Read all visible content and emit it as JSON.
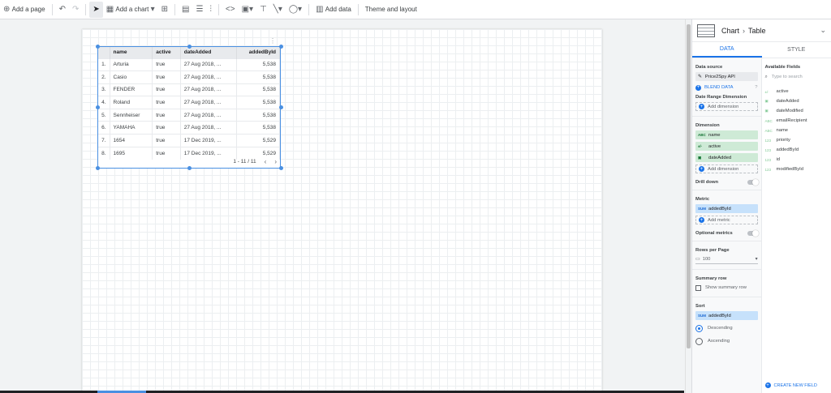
{
  "toolbar": {
    "add_page": "Add a page",
    "add_chart": "Add a chart",
    "add_data": "Add data",
    "theme": "Theme and layout"
  },
  "table": {
    "headers": [
      "name",
      "active",
      "dateAdded",
      "addedById"
    ],
    "rows": [
      {
        "idx": "1.",
        "name": "Arturia",
        "active": "true",
        "date": "27 Aug 2018, ...",
        "added": "5,538"
      },
      {
        "idx": "2.",
        "name": "Casio",
        "active": "true",
        "date": "27 Aug 2018, ...",
        "added": "5,538"
      },
      {
        "idx": "3.",
        "name": "FENDER",
        "active": "true",
        "date": "27 Aug 2018, ...",
        "added": "5,538"
      },
      {
        "idx": "4.",
        "name": "Roland",
        "active": "true",
        "date": "27 Aug 2018, ...",
        "added": "5,538"
      },
      {
        "idx": "5.",
        "name": "Sennheiser",
        "active": "true",
        "date": "27 Aug 2018, ...",
        "added": "5,538"
      },
      {
        "idx": "6.",
        "name": "YAMAHA",
        "active": "true",
        "date": "27 Aug 2018, ...",
        "added": "5,538"
      },
      {
        "idx": "7.",
        "name": "1654",
        "active": "true",
        "date": "17 Dec 2019, ...",
        "added": "5,529"
      },
      {
        "idx": "8.",
        "name": "1695",
        "active": "true",
        "date": "17 Dec 2019, ...",
        "added": "5,529"
      }
    ],
    "pager": "1 - 11 / 11"
  },
  "panel": {
    "title": "Chart",
    "subtitle": "Table",
    "tab_data": "DATA",
    "tab_style": "STYLE",
    "data_source_label": "Data source",
    "data_source": "Price2Spy API",
    "blend": "BLEND DATA",
    "date_range_label": "Date Range Dimension",
    "add_dimension": "Add dimension",
    "dimension_label": "Dimension",
    "dimensions": [
      {
        "pre": "ABC",
        "name": "name"
      },
      {
        "pre": "±/·",
        "name": "active"
      },
      {
        "pre": "▣",
        "name": "dateAdded"
      }
    ],
    "drill_down": "Drill down",
    "metric_label": "Metric",
    "metric": {
      "pre": "SUM",
      "name": "addedById"
    },
    "add_metric": "Add metric",
    "optional_metrics": "Optional metrics",
    "rows_label": "Rows per Page",
    "rows_value": "100",
    "summary_label": "Summary row",
    "show_summary": "Show summary row",
    "sort_label": "Sort",
    "sort_field": {
      "pre": "SUM",
      "name": "addedById"
    },
    "descending": "Descending",
    "ascending": "Ascending",
    "available_label": "Available Fields",
    "search_placeholder": "Type to search",
    "fields": [
      {
        "pre": "±/·",
        "name": "active"
      },
      {
        "pre": "▣",
        "name": "dateAdded"
      },
      {
        "pre": "▣",
        "name": "dateModified"
      },
      {
        "pre": "ABC",
        "name": "emailRecipient"
      },
      {
        "pre": "ABC",
        "name": "name"
      },
      {
        "pre": "123",
        "name": "priority"
      },
      {
        "pre": "123",
        "name": "addedById"
      },
      {
        "pre": "123",
        "name": "id"
      },
      {
        "pre": "123",
        "name": "modifiedById"
      }
    ],
    "create_field": "CREATE NEW FIELD"
  }
}
